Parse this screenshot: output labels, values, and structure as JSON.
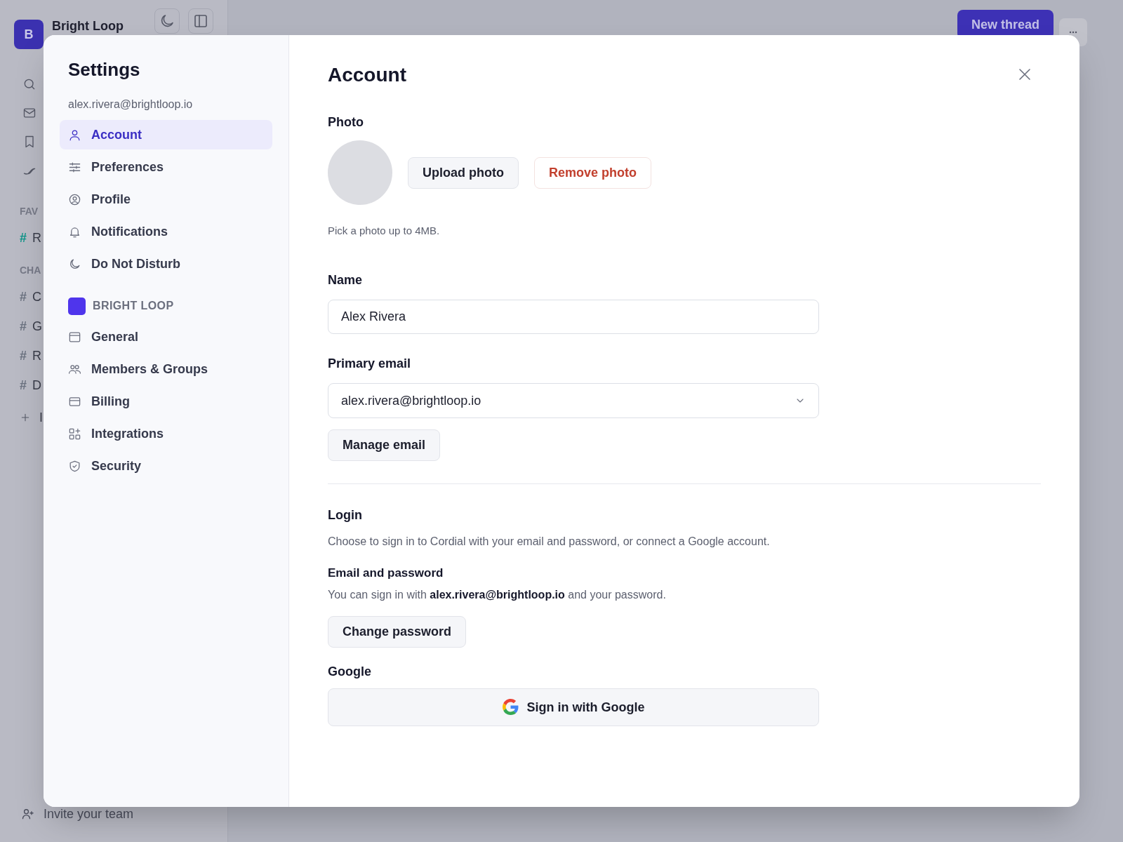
{
  "app": {
    "workspace_initial": "B",
    "workspace_name": "Bright Loop",
    "sections": [
      {
        "heading": "FAV",
        "channels": [
          {
            "mark": "#",
            "name": "R",
            "color": "#0d9488"
          }
        ]
      },
      {
        "heading": "CHA",
        "channels": [
          {
            "mark": "#",
            "name": "C",
            "color": "#6b7280"
          },
          {
            "mark": "#",
            "name": "G",
            "color": "#6b7280"
          },
          {
            "mark": "#",
            "name": "R",
            "color": "#6b7280"
          },
          {
            "mark": "#",
            "name": "D",
            "color": "#6b7280"
          }
        ]
      }
    ],
    "add_label": "I",
    "invite": "Invite your team",
    "new_thread": "New thread"
  },
  "settings": {
    "title": "Settings",
    "email": "alex.rivera@brightloop.io",
    "nav": [
      {
        "label": "Account",
        "selected": true
      },
      {
        "label": "Preferences",
        "selected": false
      },
      {
        "label": "Profile",
        "selected": false
      },
      {
        "label": "Notifications",
        "selected": false
      },
      {
        "label": "Do Not Disturb",
        "selected": false
      }
    ],
    "workspace": {
      "name": "BRIGHT LOOP",
      "items": [
        {
          "label": "General",
          "selected": false
        },
        {
          "label": "Members & Groups",
          "selected": false
        },
        {
          "label": "Billing",
          "selected": false
        },
        {
          "label": "Integrations",
          "selected": false
        },
        {
          "label": "Security",
          "selected": false
        }
      ]
    }
  },
  "account": {
    "title": "Account",
    "photo": {
      "label": "Photo",
      "upload": "Upload photo",
      "remove": "Remove photo",
      "hint": "Pick a photo up to 4MB."
    },
    "name": {
      "label": "Name",
      "value": "Alex Rivera"
    },
    "primary_email": {
      "label": "Primary email",
      "value": "alex.rivera@brightloop.io",
      "manage": "Manage email"
    },
    "login": {
      "title": "Login",
      "description": "Choose to sign in to Cordial with your email and password, or connect a Google account.",
      "email_password": {
        "title": "Email and password",
        "text": "You can sign in with **alex.rivera@brightloop.io** and your password.",
        "button": "Change password"
      },
      "google": {
        "title": "Google",
        "button": "Sign in with Google"
      }
    }
  }
}
